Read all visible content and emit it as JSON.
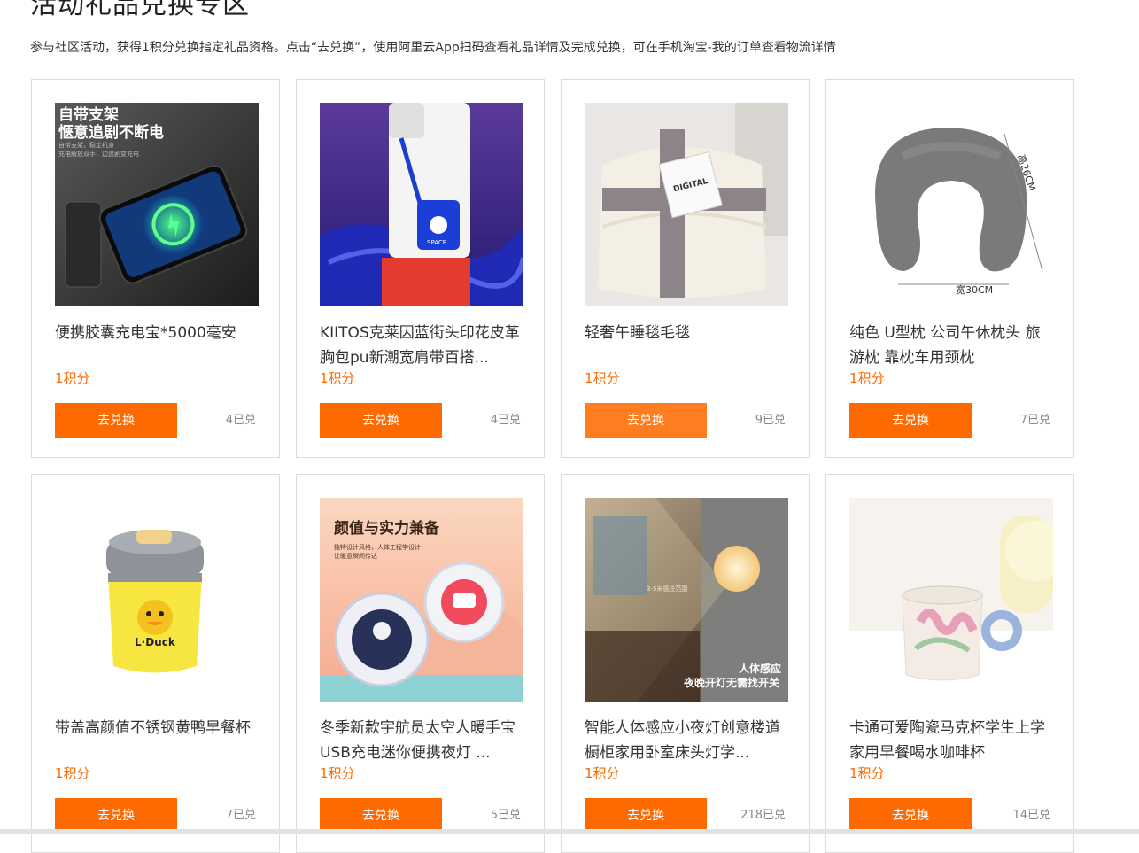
{
  "header": {
    "title": "活动礼品兑换专区",
    "description": "参与社区活动，获得1积分兑换指定礼品资格。点击“去兑换”，使用阿里云App扫码查看礼品详情及完成兑换，可在手机淘宝-我的订单查看物流详情"
  },
  "products": [
    {
      "name": "便携胶囊充电宝*5000毫安",
      "points": "1积分",
      "button": "去兑换",
      "redeemed": "4已兑",
      "image_text": {
        "line1": "自带支架",
        "line2": "惬意追剧不断电",
        "small1": "自带支架，稳定机身",
        "small2": "充电解放双手，边追剧变充电"
      }
    },
    {
      "name": "KIITOS克莱因蓝街头印花皮革胸包pu新潮宽肩带百搭...",
      "points": "1积分",
      "button": "去兑换",
      "redeemed": "4已兑",
      "image_text": {
        "badge": "SPACE"
      }
    },
    {
      "name": "轻奢午睡毯毛毯",
      "points": "1积分",
      "button": "去兑换",
      "redeemed": "9已兑",
      "image_text": {
        "tag": "DIGITAL"
      }
    },
    {
      "name": "纯色 U型枕 公司午休枕头 旅游枕 靠枕车用颈枕",
      "points": "1积分",
      "button": "去兑换",
      "redeemed": "7已兑",
      "image_text": {
        "height": "高26CM",
        "width": "宽30CM"
      }
    },
    {
      "name": "带盖高颜值不锈钢黄鸭早餐杯",
      "points": "1积分",
      "button": "去兑换",
      "redeemed": "7已兑",
      "image_text": {
        "brand": "L·Duck"
      }
    },
    {
      "name": "冬季新款宇航员太空人暖手宝 USB充电迷你便携夜灯 ...",
      "points": "1积分",
      "button": "去兑换",
      "redeemed": "5已兑",
      "image_text": {
        "headline": "颜值与实力兼备",
        "sub1": "独特设计风格，人体工程学设计",
        "sub2": "让暖意瞬间传达"
      }
    },
    {
      "name": "智能人体感应小夜灯创意楼道橱柜家用卧室床头灯学...",
      "points": "1积分",
      "button": "去兑换",
      "redeemed": "218已兑",
      "image_text": {
        "line1": "人体感应",
        "line2": "夜晚开灯无需找开关",
        "dist": "3-5米感应范围"
      }
    },
    {
      "name": "卡通可爱陶瓷马克杯学生上学家用早餐喝水咖啡杯",
      "points": "1积分",
      "button": "去兑换",
      "redeemed": "14已兑",
      "image_text": {}
    }
  ],
  "colors": {
    "accent": "#ff6a00",
    "border": "#dcdcdc"
  }
}
